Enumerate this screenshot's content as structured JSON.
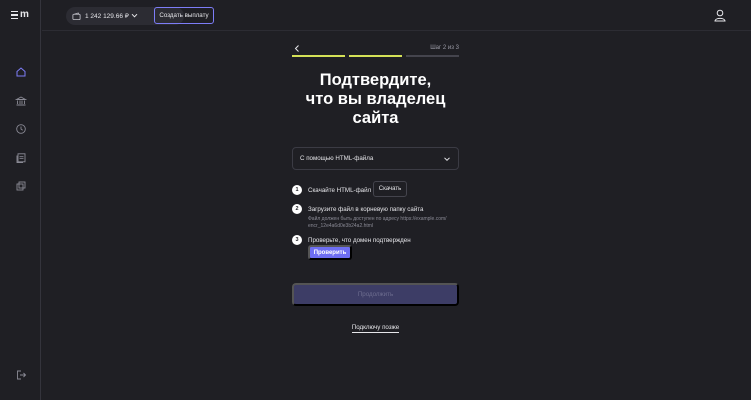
{
  "sidebar": {
    "logo_letter": "m",
    "items": [
      {
        "icon": "home-icon",
        "active": true
      },
      {
        "icon": "bank-icon",
        "active": false
      },
      {
        "icon": "clock-icon",
        "active": false
      },
      {
        "icon": "documents-icon",
        "active": false
      },
      {
        "icon": "copy-icon",
        "active": false
      }
    ],
    "logout_icon": "logout-icon"
  },
  "header": {
    "balance": "1 242 129.66 ₽",
    "payout_label": "Создать выплату",
    "user_icon": "user-icon"
  },
  "wizard": {
    "step_text": "Шаг 2 из 3",
    "progress": {
      "total": 3,
      "completed": 2
    },
    "title": "Подтвердите,\nчто вы владелец\nсайта",
    "method_select": {
      "value": "С помощью HTML-файла"
    },
    "steps": [
      {
        "number": "1",
        "label": "Скачайте HTML-файл",
        "button": "Скачать"
      },
      {
        "number": "2",
        "label": "Загрузите файл в корневую папку сайта",
        "hint": "Файл должен быть доступен по адресу https://example.com/ encr_12e4a6d0e3b24a2.html"
      },
      {
        "number": "3",
        "label": "Проверьте, что домен подтвержден",
        "button": "Проверить"
      }
    ],
    "continue_label": "Продолжить",
    "later_label": "Подключу позже"
  },
  "colors": {
    "background": "#1f1f24",
    "accent": "#6e6ef2",
    "progress_active": "#d4e157",
    "progress_inactive": "#44444d",
    "disabled_button": "#3d3d66"
  }
}
